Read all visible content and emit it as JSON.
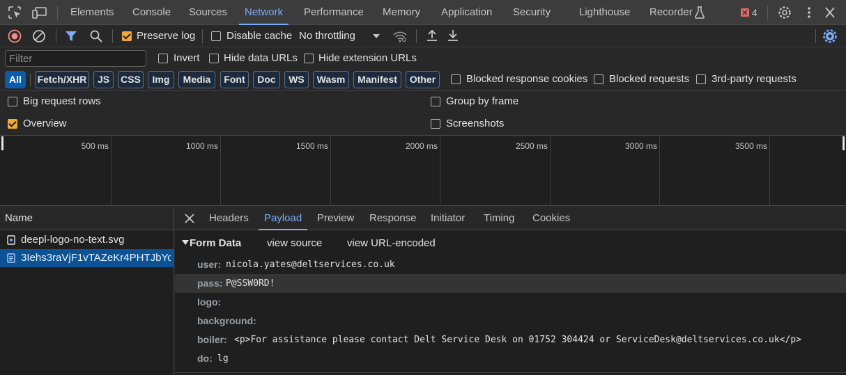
{
  "tabs": [
    "Elements",
    "Console",
    "Sources",
    "Network",
    "Performance",
    "Memory",
    "Application",
    "Security",
    "Lighthouse",
    "Recorder"
  ],
  "active_tab": "Network",
  "issue_count": "4",
  "toolbar": {
    "preserve_log": "Preserve log",
    "disable_cache": "Disable cache",
    "throttling": "No throttling"
  },
  "filter": {
    "placeholder": "Filter",
    "invert": "Invert",
    "hide_data_urls": "Hide data URLs",
    "hide_extension_urls": "Hide extension URLs"
  },
  "type_filters": [
    "All",
    "Fetch/XHR",
    "JS",
    "CSS",
    "Img",
    "Media",
    "Font",
    "Doc",
    "WS",
    "Wasm",
    "Manifest",
    "Other"
  ],
  "type_filter_selected": "All",
  "extra_filters": {
    "blocked_response_cookies": "Blocked response cookies",
    "blocked_requests": "Blocked requests",
    "third_party_requests": "3rd-party requests"
  },
  "settings": {
    "big_request_rows": "Big request rows",
    "group_by_frame": "Group by frame",
    "overview": "Overview",
    "screenshots": "Screenshots"
  },
  "timeline_ticks": [
    "500 ms",
    "1000 ms",
    "1500 ms",
    "2000 ms",
    "2500 ms",
    "3000 ms",
    "3500 ms"
  ],
  "requests": {
    "header": "Name",
    "items": [
      "deepl-logo-no-text.svg",
      "3Iehs3raVjF1vTAZeKr4PHTJbYo..."
    ]
  },
  "detail": {
    "tabs": [
      "Headers",
      "Payload",
      "Preview",
      "Response",
      "Initiator",
      "Timing",
      "Cookies"
    ],
    "active_tab": "Payload",
    "section_title": "Form Data",
    "view_source": "view source",
    "view_url_encoded": "view URL-encoded",
    "fields": [
      {
        "key": "user:",
        "value": "nicola.yates@deltservices.co.uk"
      },
      {
        "key": "pass:",
        "value": "P@SSW0RD!"
      },
      {
        "key": "logo:",
        "value": ""
      },
      {
        "key": "background:",
        "value": ""
      },
      {
        "key": "boiler:",
        "value": "<p>For assistance please contact Delt Service Desk on 01752 304424 or ServiceDesk@deltservices.co.uk</p>"
      },
      {
        "key": "do:",
        "value": "lg"
      }
    ]
  },
  "colors": {
    "accent": "#7cacf8",
    "checkbox_on": "#f2a93b",
    "selected_row": "#0b5394",
    "record_red": "#f28b82"
  }
}
